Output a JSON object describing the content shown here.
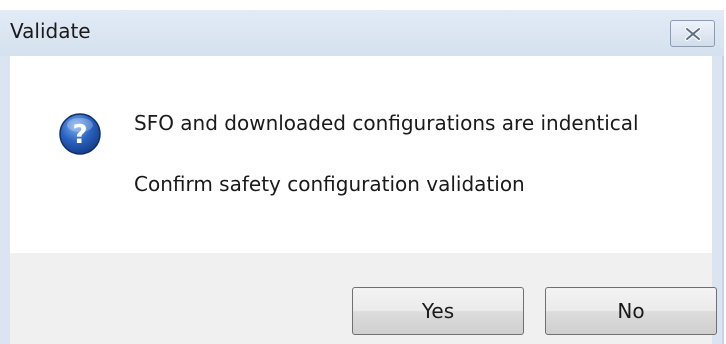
{
  "window": {
    "title": "Validate"
  },
  "icons": {
    "message": "question-icon",
    "close": "close-icon"
  },
  "message": {
    "line1": "SFO and downloaded configurations are indentical",
    "line2": "Confirm safety configuration validation"
  },
  "buttons": {
    "yes_label": "Yes",
    "no_label": "No"
  },
  "colors": {
    "title_bar": "#dbe5f2",
    "icon_blue": "#1f4fa8",
    "client_bg": "#f0f0f0"
  }
}
